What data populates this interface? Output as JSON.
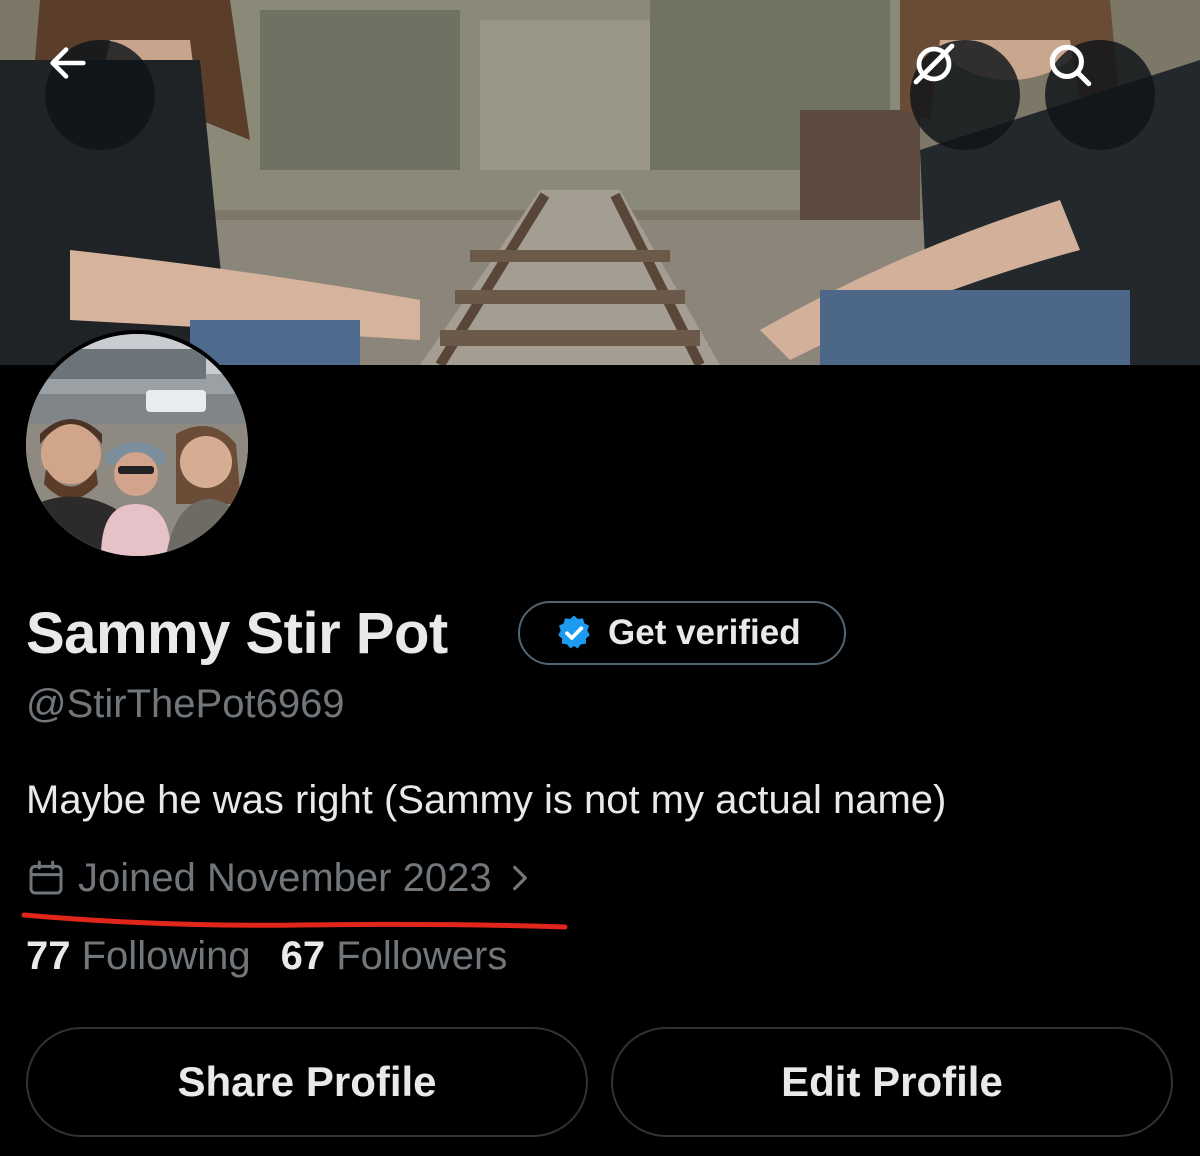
{
  "header": {
    "back_icon": "arrow-left-icon",
    "grok_icon": "grok-icon",
    "search_icon": "search-icon"
  },
  "profile": {
    "display_name": "Sammy Stir Pot",
    "get_verified_label": "Get verified",
    "handle": "@StirThePot6969",
    "bio": "Maybe he was right (Sammy is not my actual name)",
    "joined_text": "Joined November 2023",
    "following_count": "77",
    "following_label": "Following",
    "followers_count": "67",
    "followers_label": "Followers"
  },
  "actions": {
    "share_label": "Share Profile",
    "edit_label": "Edit Profile"
  },
  "colors": {
    "background": "#000000",
    "text_primary": "#e7e9ea",
    "text_secondary": "#71767b",
    "verified_blue": "#1d9bf0",
    "annotation_red": "#e0251b"
  }
}
